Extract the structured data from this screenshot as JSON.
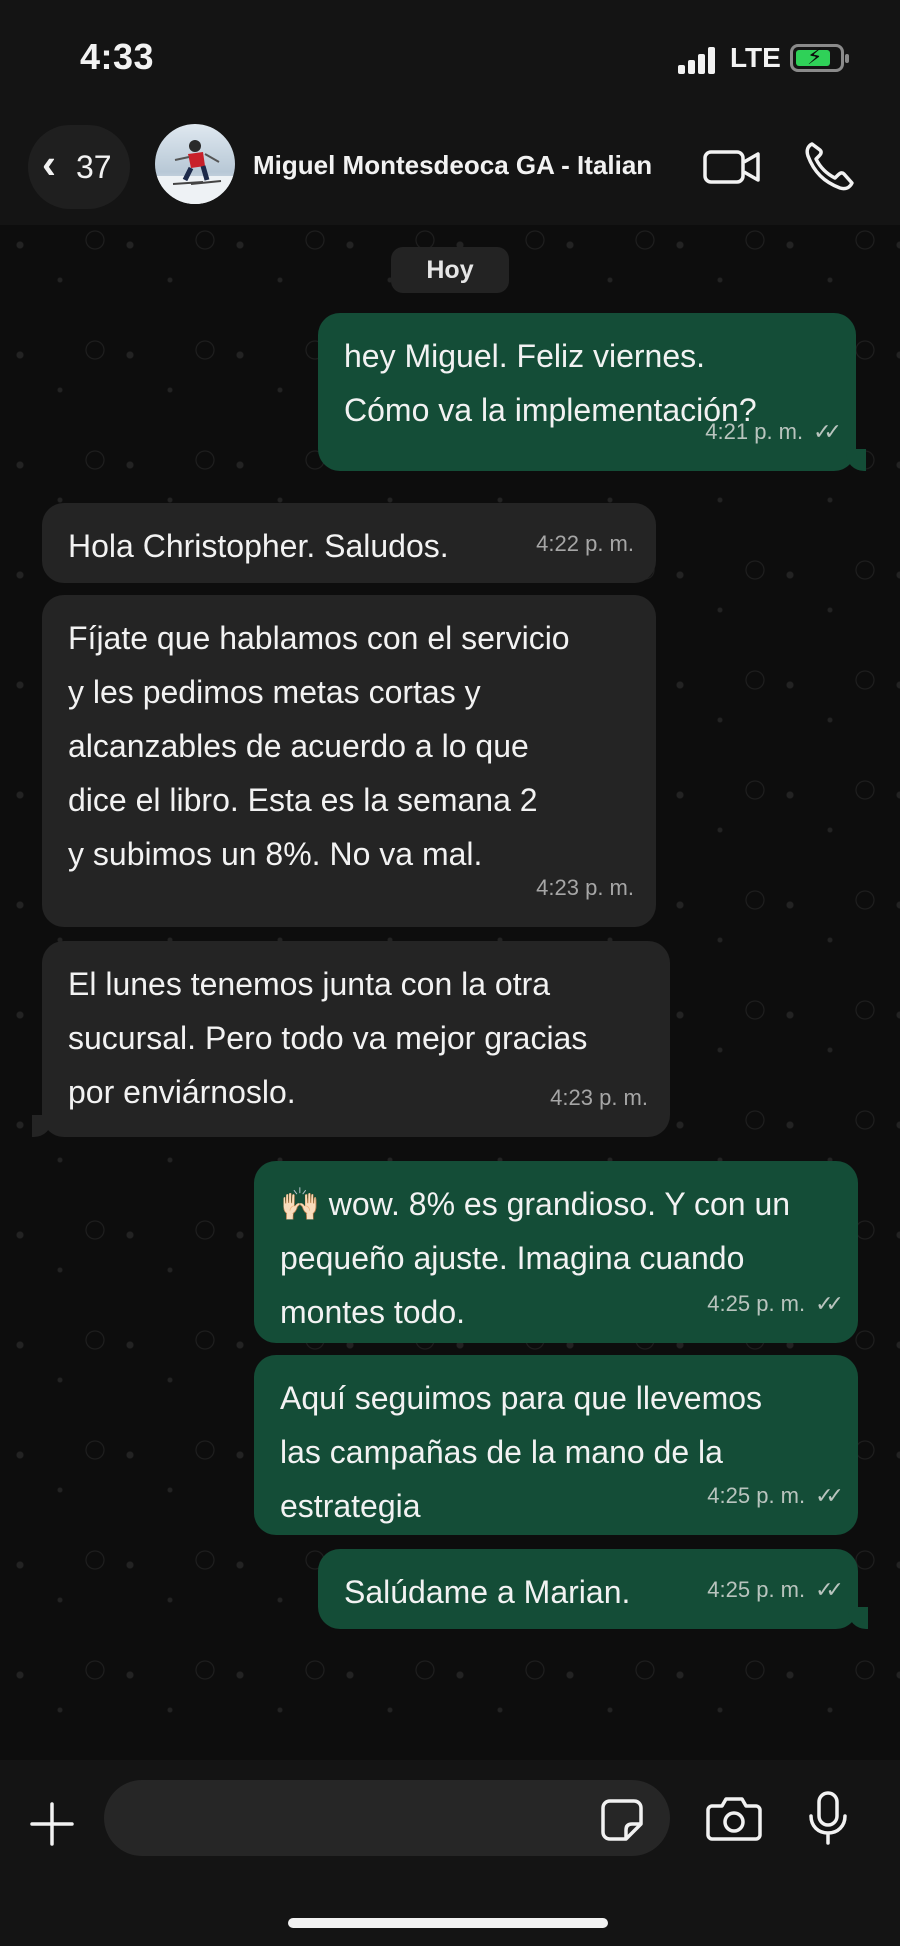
{
  "status_bar": {
    "time": "4:33",
    "network": "LTE",
    "battery_charging": true
  },
  "header": {
    "back_count": "37",
    "contact_name": "Miguel Montesdeoca GA - Italian",
    "icons": [
      "chevron-left-icon",
      "video-camera-icon",
      "phone-icon"
    ]
  },
  "chat": {
    "date_label": "Hoy",
    "messages": [
      {
        "direction": "out",
        "text": "hey Miguel. Feliz viernes.\nCómo va la implementación?",
        "time": "4:21 p. m.",
        "status": "read"
      },
      {
        "direction": "in",
        "text": "Hola Christopher. Saludos.",
        "time": "4:22 p. m."
      },
      {
        "direction": "in",
        "text": "Fíjate que hablamos con el servicio\ny les pedimos metas cortas y\nalcanzables de acuerdo a lo que\ndice el libro. Esta es la semana 2\ny subimos un 8%. No va mal.",
        "time": "4:23 p. m."
      },
      {
        "direction": "in",
        "text": "El lunes tenemos junta con la otra\nsucursal. Pero todo va mejor gracias\npor enviárnoslo.",
        "time": "4:23 p. m."
      },
      {
        "direction": "out",
        "text": "🙌🏻 wow. 8% es grandioso. Y con un\npequeño ajuste. Imagina cuando\nmontes todo.",
        "time": "4:25 p. m.",
        "status": "read"
      },
      {
        "direction": "out",
        "text": "Aquí seguimos para que llevemos\nlas campañas de la mano de la\nestrategia",
        "time": "4:25 p. m.",
        "status": "read"
      },
      {
        "direction": "out",
        "text": "Salúdame a Marian.",
        "time": "4:25 p. m.",
        "status": "read"
      }
    ]
  },
  "composer": {
    "placeholder": "",
    "icons": [
      "plus-icon",
      "sticker-icon",
      "camera-icon",
      "microphone-icon"
    ]
  },
  "colors": {
    "outgoing_bubble": "#144d37",
    "incoming_bubble": "#242424",
    "background": "#0d0d0d"
  }
}
